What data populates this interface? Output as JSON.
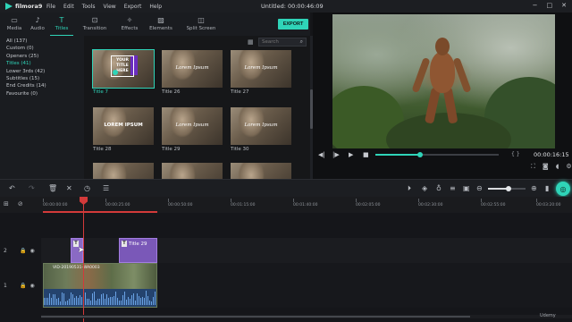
{
  "app": {
    "name": "filmora9",
    "window_title": "Untitled:  00:00:46:09",
    "menu": [
      "File",
      "Edit",
      "Tools",
      "View",
      "Export",
      "Help"
    ],
    "window_controls": [
      "−",
      "□",
      "✕"
    ]
  },
  "modules": [
    {
      "label": "Media",
      "icon": "folder-icon",
      "active": false
    },
    {
      "label": "Audio",
      "icon": "music-note-icon",
      "active": false
    },
    {
      "label": "Titles",
      "icon": "text-icon",
      "active": true
    },
    {
      "label": "Transition",
      "icon": "transition-icon",
      "active": false
    },
    {
      "label": "Effects",
      "icon": "effects-icon",
      "active": false
    },
    {
      "label": "Elements",
      "icon": "image-icon",
      "active": false
    },
    {
      "label": "Split Screen",
      "icon": "split-screen-icon",
      "active": false
    }
  ],
  "export_label": "EXPORT",
  "categories": [
    {
      "label": "All (137)",
      "active": false
    },
    {
      "label": "Custom (0)",
      "active": false
    },
    {
      "label": "Openers (25)",
      "active": false
    },
    {
      "label": "Titles (41)",
      "active": true
    },
    {
      "label": "Lower 3rds (42)",
      "active": false
    },
    {
      "label": "Subtitles (15)",
      "active": false
    },
    {
      "label": "End Credits (14)",
      "active": false
    },
    {
      "label": "Favourite (0)",
      "active": false
    }
  ],
  "search": {
    "placeholder": "Search"
  },
  "tiles": [
    {
      "label": "Title 7",
      "text": "YOUR TITLE HERE",
      "selected": true
    },
    {
      "label": "Title 26",
      "text": "Lorem Ipsum",
      "selected": false
    },
    {
      "label": "Title 27",
      "text": "Lorem Ipsum",
      "selected": false
    },
    {
      "label": "Title 28",
      "text": "LOREM IPSUM",
      "selected": false
    },
    {
      "label": "Title 29",
      "text": "Lorem Ipsum",
      "selected": false
    },
    {
      "label": "Title 30",
      "text": "Lorem Ipsum",
      "selected": false
    }
  ],
  "preview": {
    "timecode": "00:00:16:15",
    "progress": 0.36,
    "braces": "{ }"
  },
  "ruler_ticks": [
    "00:00:00:00",
    "00:00:25:00",
    "00:00:50:00",
    "00:01:15:00",
    "00:01:40:00",
    "00:02:05:00",
    "00:02:30:00",
    "00:02:55:00",
    "00:03:20:00"
  ],
  "zoom_level": 0.55,
  "tracks": {
    "title_track_label": "2",
    "video_track_label": "1",
    "title_clips": [
      {
        "label": "T"
      },
      {
        "label": "Title 29"
      }
    ],
    "video_clip_label": "VID-20190531-WA0003"
  },
  "watermark": "Udemy"
}
